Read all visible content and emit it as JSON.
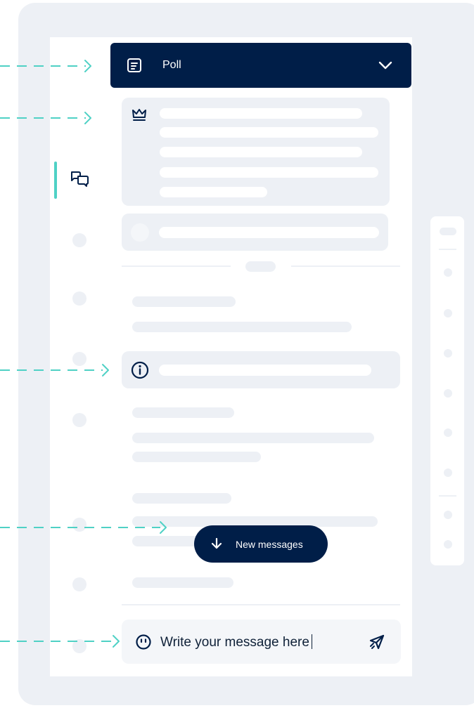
{
  "poll": {
    "title": "Poll",
    "icon": "poll-icon",
    "toggle_icon": "chevron-down-icon"
  },
  "chat_input": {
    "placeholder": "Write your message here",
    "emoji_icon": "emoji-icon",
    "send_icon": "send-icon"
  },
  "new_messages": {
    "label": "New messages",
    "icon": "arrow-down-icon"
  },
  "sidebar": {
    "active_icon": "chat-bubbles-icon"
  },
  "colors": {
    "navy": "#001e48",
    "accent_teal": "#4fd1c5",
    "placeholder_gray": "#edf0f5",
    "panel_bg": "#ffffff",
    "frame_bg": "#edf0f5"
  }
}
